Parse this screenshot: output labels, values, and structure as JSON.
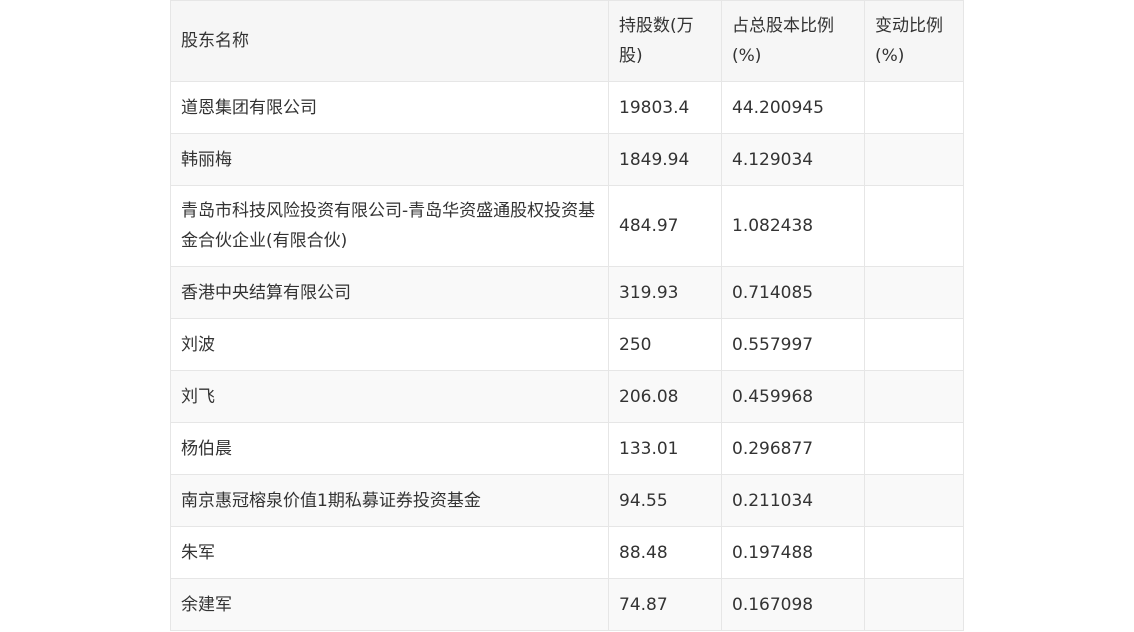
{
  "table": {
    "headers": [
      "股东名称",
      "持股数(万股)",
      "占总股本比例(%)",
      "变动比例(%)"
    ],
    "rows": [
      {
        "name": "道恩集团有限公司",
        "shares": "19803.4",
        "ratio": "44.200945",
        "change": ""
      },
      {
        "name": "韩丽梅",
        "shares": "1849.94",
        "ratio": "4.129034",
        "change": ""
      },
      {
        "name": "青岛市科技风险投资有限公司-青岛华资盛通股权投资基金合伙企业(有限合伙)",
        "shares": "484.97",
        "ratio": "1.082438",
        "change": ""
      },
      {
        "name": "香港中央结算有限公司",
        "shares": "319.93",
        "ratio": "0.714085",
        "change": ""
      },
      {
        "name": "刘波",
        "shares": "250",
        "ratio": "0.557997",
        "change": ""
      },
      {
        "name": "刘飞",
        "shares": "206.08",
        "ratio": "0.459968",
        "change": ""
      },
      {
        "name": "杨伯晨",
        "shares": "133.01",
        "ratio": "0.296877",
        "change": ""
      },
      {
        "name": "南京惠冠榕泉价值1期私募证券投资基金",
        "shares": "94.55",
        "ratio": "0.211034",
        "change": ""
      },
      {
        "name": "朱军",
        "shares": "88.48",
        "ratio": "0.197488",
        "change": ""
      },
      {
        "name": "余建军",
        "shares": "74.87",
        "ratio": "0.167098",
        "change": ""
      }
    ]
  }
}
